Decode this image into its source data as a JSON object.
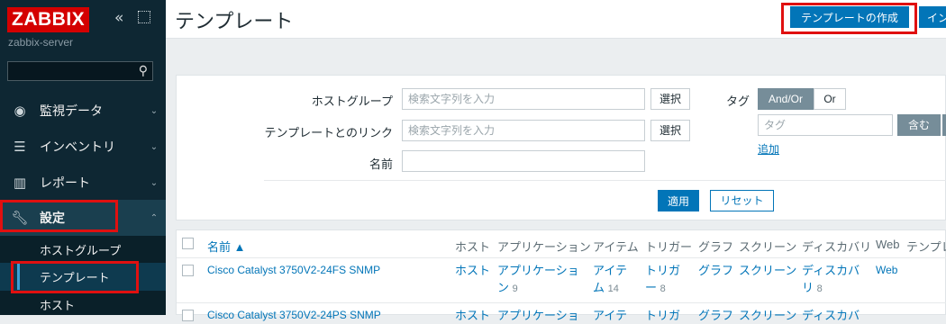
{
  "sidebar": {
    "logo": "ZABBIX",
    "server": "zabbix-server",
    "search_placeholder": "",
    "items": [
      {
        "label": "監視データ",
        "icon": "eye-icon"
      },
      {
        "label": "インベントリ",
        "icon": "list-icon"
      },
      {
        "label": "レポート",
        "icon": "bar-chart-icon"
      },
      {
        "label": "設定",
        "icon": "wrench-icon"
      }
    ],
    "subitems": [
      "ホストグループ",
      "テンプレート",
      "ホスト"
    ]
  },
  "header": {
    "title": "テンプレート",
    "create_button": "テンプレートの作成",
    "import_button": "イン"
  },
  "filter": {
    "hostgroup_label": "ホストグループ",
    "hostgroup_placeholder": "検索文字列を入力",
    "linked_label": "テンプレートとのリンク",
    "linked_placeholder": "検索文字列を入力",
    "name_label": "名前",
    "select_button": "選択",
    "tag_label": "タグ",
    "andor": "And/Or",
    "or": "Or",
    "tag_placeholder": "タグ",
    "contains": "含む",
    "add_link": "追加",
    "apply": "適用",
    "reset": "リセット"
  },
  "table": {
    "headers": [
      "名前 ▲",
      "ホスト",
      "アプリケーション",
      "アイテム",
      "トリガー",
      "グラフ",
      "スクリーン",
      "ディスカバリ",
      "Web",
      "テンプレ"
    ],
    "rows": [
      {
        "name": "Cisco Catalyst 3750V2-24FS SNMP",
        "host": "ホスト",
        "app": "アプリケーショ",
        "app2": "ン",
        "app_count": "9",
        "item": "アイテ",
        "item2": "ム",
        "item_count": "14",
        "trigger": "トリガ",
        "trigger2": "ー",
        "trigger_count": "8",
        "graph": "グラフ",
        "screen": "スクリーン",
        "discovery": "ディスカバ",
        "discovery2": "リ",
        "discovery_count": "8",
        "web": "Web"
      },
      {
        "name": "Cisco Catalyst 3750V2-24PS SNMP",
        "host": "ホスト",
        "app": "アプリケーショ",
        "item": "アイテ",
        "trigger": "トリガ",
        "graph": "グラフ",
        "screen": "スクリーン",
        "discovery": "ディスカバ"
      }
    ]
  }
}
